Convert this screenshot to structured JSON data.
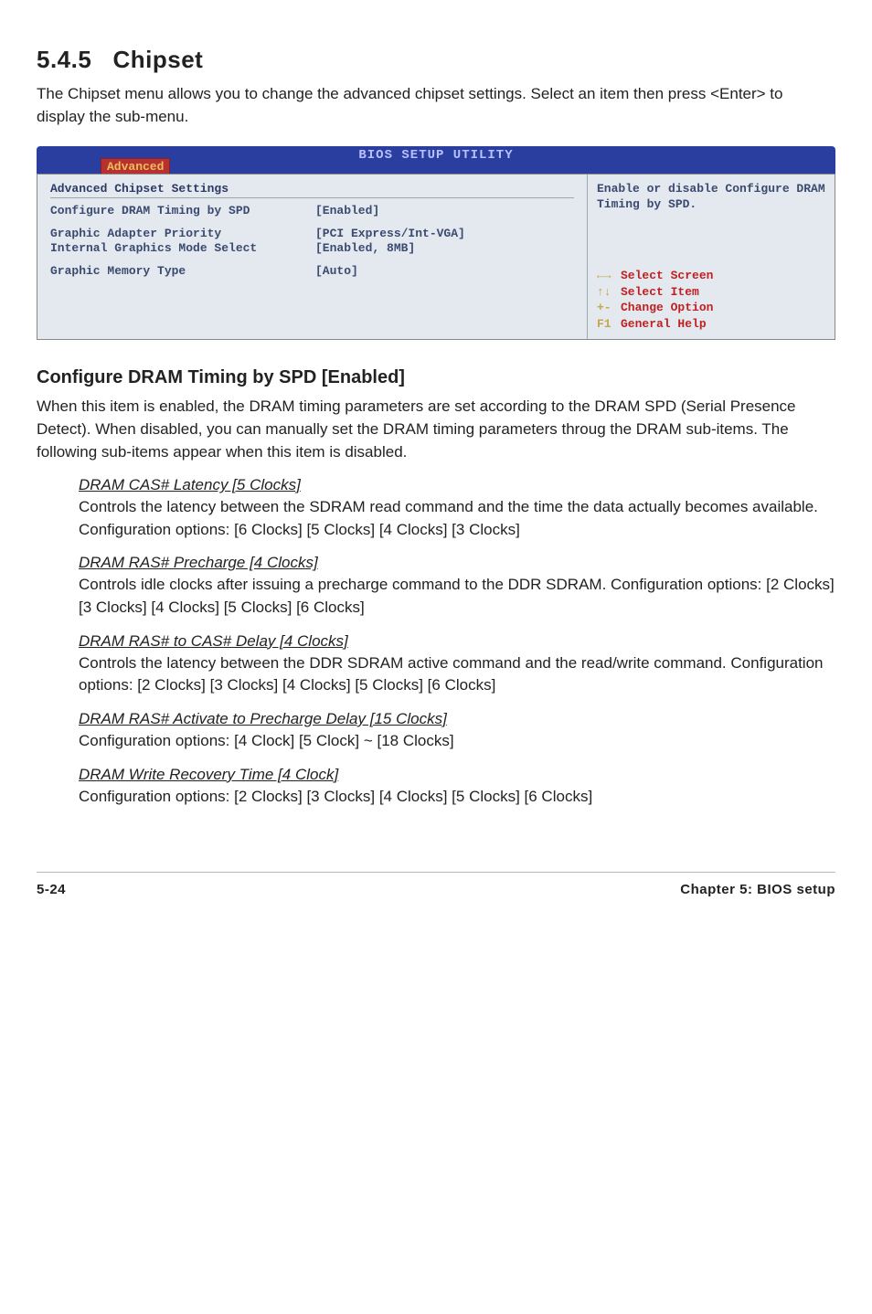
{
  "section": {
    "number": "5.4.5",
    "title": "Chipset"
  },
  "intro": "The Chipset menu allows you to change the advanced chipset settings. Select an item then press <Enter> to display the sub-menu.",
  "bios": {
    "title": "BIOS SETUP UTILITY",
    "tab": "Advanced",
    "heading": "Advanced Chipset Settings",
    "rows": [
      {
        "label": "Configure DRAM Timing by SPD",
        "value": "[Enabled]"
      },
      {
        "label": "Graphic Adapter Priority",
        "value": "[PCI Express/Int-VGA]"
      },
      {
        "label": "Internal Graphics Mode Select",
        "value": "[Enabled, 8MB]"
      },
      {
        "label": "Graphic Memory Type",
        "value": "[Auto]"
      }
    ],
    "help_top": "Enable or disable Configure DRAM Timing by SPD.",
    "keys": [
      {
        "k": "←→",
        "t": "Select Screen"
      },
      {
        "k": "↑↓",
        "t": "Select Item"
      },
      {
        "k": "+-",
        "t": "Change Option"
      },
      {
        "k": "F1",
        "t": "General Help"
      }
    ]
  },
  "subhead": "Configure DRAM Timing by SPD [Enabled]",
  "subdesc": "When this item is enabled, the DRAM timing parameters are set according to the DRAM SPD (Serial Presence Detect). When disabled, you can manually set the DRAM timing parameters throug the DRAM sub-items. The following sub-items appear when this item is disabled.",
  "items": [
    {
      "title": "DRAM CAS# Latency [5 Clocks]",
      "desc": "Controls the latency between the SDRAM read command and the time the data actually becomes available. Configuration options: [6 Clocks] [5 Clocks] [4 Clocks] [3 Clocks]"
    },
    {
      "title": "DRAM RAS# Precharge [4 Clocks]",
      "desc": "Controls idle clocks after issuing a precharge command to the DDR SDRAM. Configuration options: [2 Clocks] [3 Clocks] [4 Clocks] [5 Clocks] [6 Clocks]"
    },
    {
      "title": "DRAM RAS#  to CAS# Delay [4 Clocks]",
      "desc": "Controls the latency between the DDR SDRAM active command and the read/write command. Configuration options: [2 Clocks] [3 Clocks] [4 Clocks] [5 Clocks] [6 Clocks]"
    },
    {
      "title": "DRAM RAS# Activate to Precharge Delay [15 Clocks]",
      "desc": "Configuration options: [4 Clock] [5 Clock] ~ [18 Clocks]"
    },
    {
      "title": "DRAM Write Recovery Time [4 Clock]",
      "desc": "Configuration options: [2 Clocks] [3 Clocks] [4 Clocks] [5 Clocks] [6 Clocks]"
    }
  ],
  "footer": {
    "left": "5-24",
    "right": "Chapter 5: BIOS setup"
  }
}
